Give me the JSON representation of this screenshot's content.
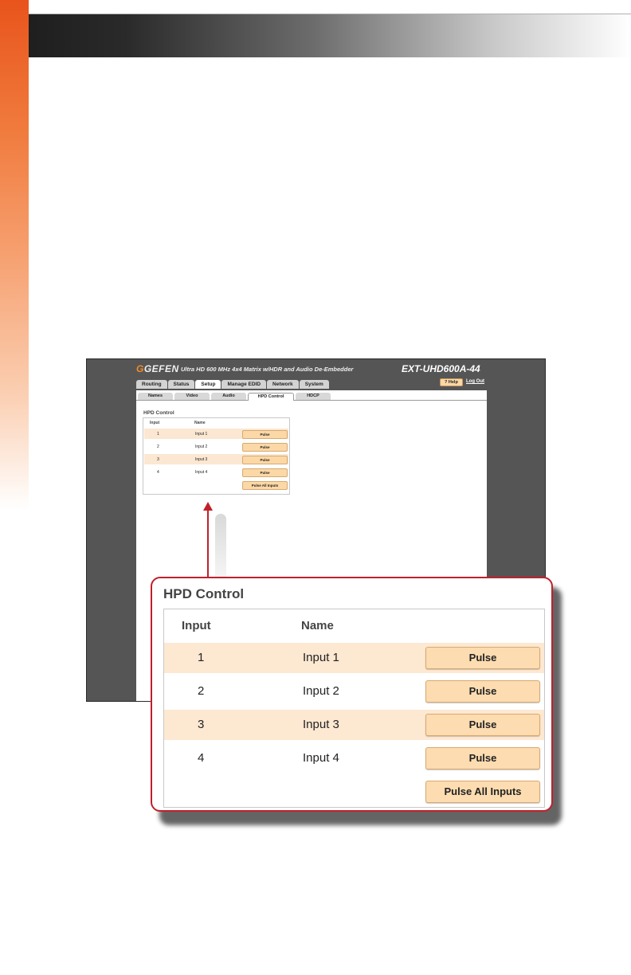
{
  "brand": {
    "logo_mark": "G",
    "logo_text": "GEFEN",
    "subtitle": "Ultra HD 600 MHz 4x4 Matrix w/HDR and Audio De-Embedder",
    "model": "EXT-UHD600A-44"
  },
  "nav": {
    "tabs": [
      "Routing",
      "Status",
      "Setup",
      "Manage EDID",
      "Network",
      "System"
    ],
    "active_tab": "Setup",
    "help_label": "? Help",
    "logout_label": "Log Out"
  },
  "setup": {
    "subtabs": [
      "Names",
      "Video",
      "Audio",
      "HPD Control",
      "HDCP"
    ],
    "active_subtab": "HPD Control"
  },
  "hpd": {
    "title": "HPD Control",
    "col_input": "Input",
    "col_name": "Name",
    "rows": [
      {
        "input": "1",
        "name": "Input 1",
        "button": "Pulse"
      },
      {
        "input": "2",
        "name": "Input 2",
        "button": "Pulse"
      },
      {
        "input": "3",
        "name": "Input 3",
        "button": "Pulse"
      },
      {
        "input": "4",
        "name": "Input 4",
        "button": "Pulse"
      }
    ],
    "pulse_all_label": "Pulse All Inputs"
  },
  "colors": {
    "accent": "#c0202a",
    "row_highlight": "#fde8d2",
    "button": "#fcdcb0",
    "brand_orange": "#f28a26"
  }
}
